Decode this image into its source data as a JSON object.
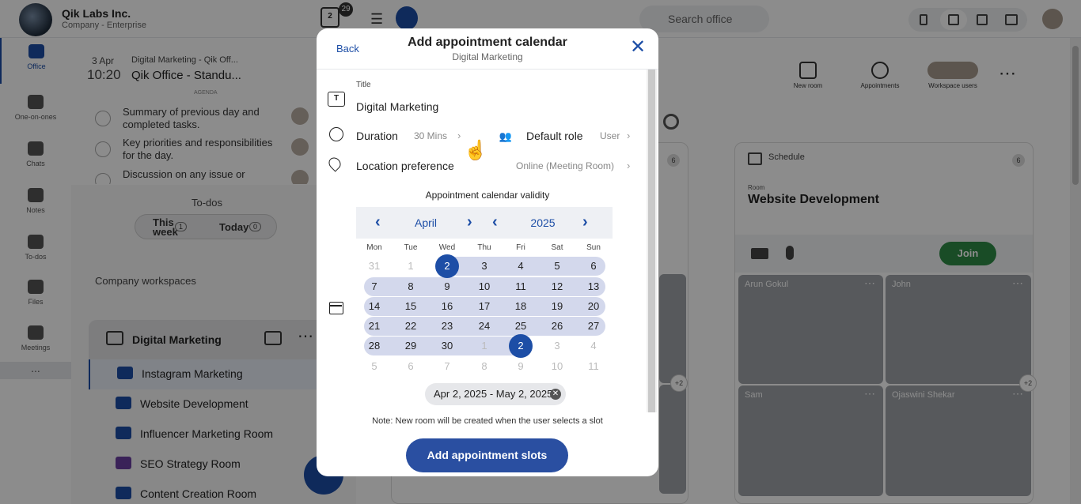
{
  "app": {
    "company_name": "Qik Labs Inc.",
    "company_sub": "Company - Enterprise",
    "calendar_day": "2",
    "calendar_badge": "29",
    "search_placeholder": "Search office"
  },
  "sidebar": {
    "items": [
      {
        "label": "Office"
      },
      {
        "label": "One-on-ones"
      },
      {
        "label": "Chats"
      },
      {
        "label": "Notes"
      },
      {
        "label": "To-dos"
      },
      {
        "label": "Files"
      },
      {
        "label": "Meetings"
      }
    ],
    "more": "..."
  },
  "agenda": {
    "date": "3 Apr",
    "time": "10:20",
    "meta": "Digital Marketing - Qik Off...",
    "title": "Qik Office - Standu...",
    "section_label": "AGENDA",
    "items": [
      {
        "text": "Summary of previous day and completed tasks."
      },
      {
        "text": "Key priorities and responsibilities for the day."
      },
      {
        "text": "Discussion on any issue or"
      }
    ]
  },
  "todos": {
    "title": "To-dos",
    "tab_this_week": "This week",
    "tab_this_week_count": "1",
    "tab_today": "Today",
    "tab_today_count": "0"
  },
  "workspaces": {
    "label": "Company workspaces",
    "current": "Digital Marketing",
    "rooms": [
      {
        "name": "Instagram Marketing",
        "color": "#1d4ea6"
      },
      {
        "name": "Website Development",
        "color": "#1d4ea6"
      },
      {
        "name": "Influencer Marketing Room",
        "color": "#1d4ea6"
      },
      {
        "name": "SEO Strategy Room",
        "color": "#6b3fa0"
      },
      {
        "name": "Content Creation Room",
        "color": "#1d4ea6"
      }
    ]
  },
  "toolbar": {
    "new_room": "New room",
    "appointments": "Appointments",
    "workspace_users": "Workspace users"
  },
  "schedule_card": {
    "label": "Schedule",
    "badge": "6",
    "room_label": "Room",
    "room_title": "Website Development",
    "join": "Join",
    "participants": [
      {
        "name": "Arun Gokul"
      },
      {
        "name": "John"
      },
      {
        "name": "Sam"
      },
      {
        "name": "Ojaswini Shekar"
      }
    ],
    "more_count": "+2"
  },
  "left_card": {
    "badge": "6",
    "more_count": "+2"
  },
  "modal": {
    "back": "Back",
    "title": "Add appointment calendar",
    "subtitle": "Digital Marketing",
    "title_label": "Title",
    "title_value": "Digital Marketing",
    "duration_label": "Duration",
    "duration_value": "30 Mins",
    "role_label": "Default role",
    "role_value": "User",
    "location_label": "Location preference",
    "location_value": "Online (Meeting Room)",
    "validity_label": "Appointment calendar validity",
    "month": "April",
    "year": "2025",
    "weekdays": [
      "Mon",
      "Tue",
      "Wed",
      "Thu",
      "Fri",
      "Sat",
      "Sun"
    ],
    "weeks": [
      [
        "31",
        "1",
        "2",
        "3",
        "4",
        "5",
        "6"
      ],
      [
        "7",
        "8",
        "9",
        "10",
        "11",
        "12",
        "13"
      ],
      [
        "14",
        "15",
        "16",
        "17",
        "18",
        "19",
        "20"
      ],
      [
        "21",
        "22",
        "23",
        "24",
        "25",
        "26",
        "27"
      ],
      [
        "28",
        "29",
        "30",
        "1",
        "2",
        "3",
        "4"
      ],
      [
        "5",
        "6",
        "7",
        "8",
        "9",
        "10",
        "11"
      ]
    ],
    "range_text": "Apr 2, 2025 - May 2, 2025",
    "note": "Note: New room will be created when the user selects a slot",
    "submit": "Add appointment slots"
  },
  "colors": {
    "accent": "#1d4ea6",
    "range_band": "#d3d8ec",
    "join_green": "#2e8b45"
  }
}
